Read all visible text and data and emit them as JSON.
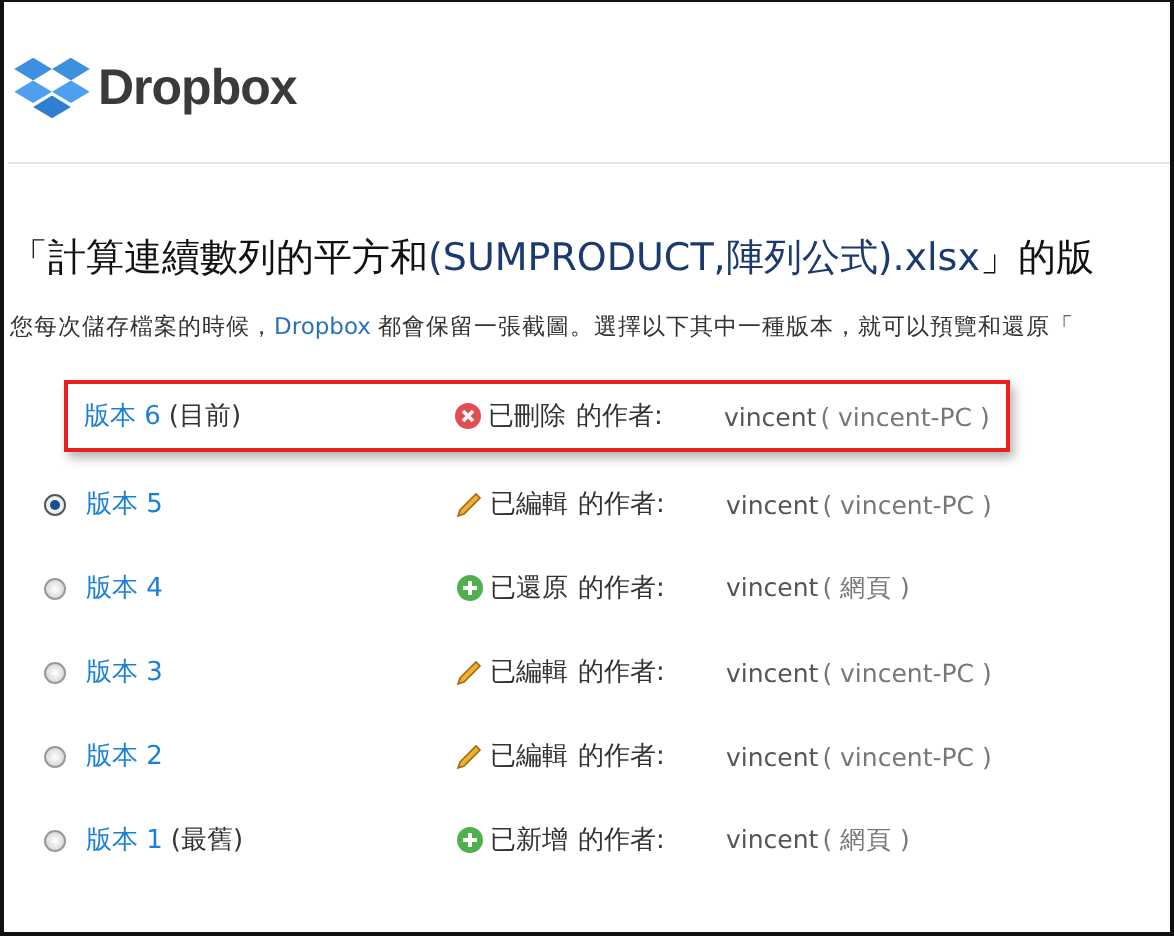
{
  "logo": {
    "text": "Dropbox"
  },
  "title": {
    "prefix": "「計算連續數列的平方和",
    "file": "(SUMPRODUCT,陣列公式).xlsx",
    "suffix": "」的版"
  },
  "description": {
    "before": "您每次儲存檔案的時候，",
    "link": "Dropbox",
    "after": " 都會保留一張截圖。選擇以下其中一種版本，就可以預覽和還原「"
  },
  "versions": [
    {
      "label": "版本 6",
      "note": "(目前)",
      "radio": false,
      "highlighted": true,
      "kind": "deleted",
      "action": "已刪除",
      "by": "的作者:",
      "author": "vincent",
      "source": "( vincent-PC )"
    },
    {
      "label": "版本 5",
      "radio": true,
      "selected": true,
      "highlighted": false,
      "kind": "edited",
      "action": "已編輯",
      "by": "的作者:",
      "author": "vincent",
      "source": "( vincent-PC )"
    },
    {
      "label": "版本 4",
      "radio": true,
      "selected": false,
      "highlighted": false,
      "kind": "restored",
      "action": "已還原",
      "by": "的作者:",
      "author": "vincent",
      "source": "( 網頁 )"
    },
    {
      "label": "版本 3",
      "radio": true,
      "selected": false,
      "highlighted": false,
      "kind": "edited",
      "action": "已編輯",
      "by": "的作者:",
      "author": "vincent",
      "source": "( vincent-PC )"
    },
    {
      "label": "版本 2",
      "radio": true,
      "selected": false,
      "highlighted": false,
      "kind": "edited",
      "action": "已編輯",
      "by": "的作者:",
      "author": "vincent",
      "source": "( vincent-PC )"
    },
    {
      "label": "版本 1",
      "note": "(最舊)",
      "radio": true,
      "selected": false,
      "highlighted": false,
      "kind": "added",
      "action": "已新增",
      "by": "的作者:",
      "author": "vincent",
      "source": "( 網頁 )"
    }
  ]
}
